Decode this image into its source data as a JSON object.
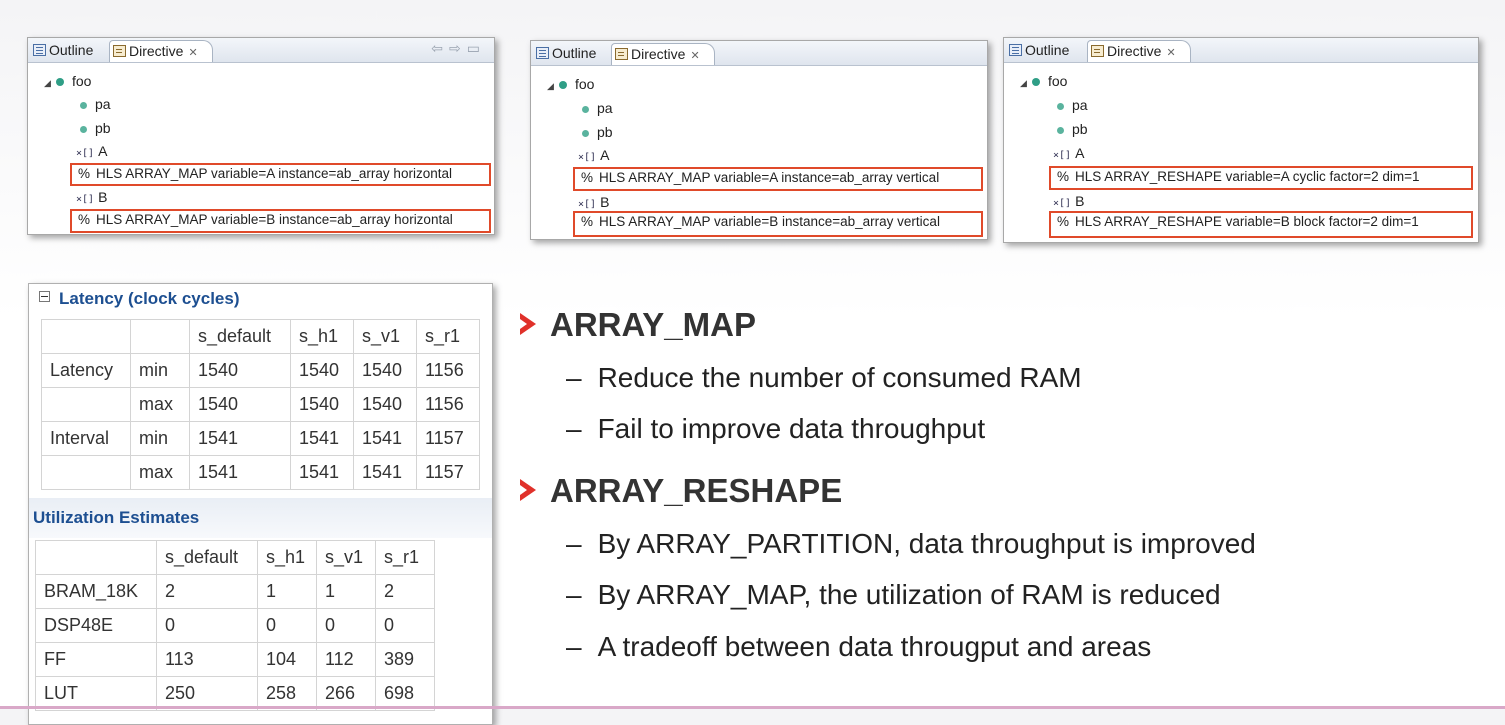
{
  "panels": [
    {
      "tabs": {
        "outline": "Outline",
        "directive": "Directive"
      },
      "tree": {
        "func": "foo",
        "ports": [
          "pa",
          "pb"
        ],
        "arrays": [
          "A",
          "B"
        ],
        "directives": [
          "HLS ARRAY_MAP variable=A instance=ab_array horizontal",
          "HLS ARRAY_MAP variable=B instance=ab_array horizontal"
        ]
      }
    },
    {
      "tabs": {
        "outline": "Outline",
        "directive": "Directive"
      },
      "tree": {
        "func": "foo",
        "ports": [
          "pa",
          "pb"
        ],
        "arrays": [
          "A",
          "B"
        ],
        "directives": [
          "HLS ARRAY_MAP variable=A instance=ab_array vertical",
          "HLS ARRAY_MAP variable=B instance=ab_array vertical"
        ]
      }
    },
    {
      "tabs": {
        "outline": "Outline",
        "directive": "Directive"
      },
      "tree": {
        "func": "foo",
        "ports": [
          "pa",
          "pb"
        ],
        "arrays": [
          "A",
          "B"
        ],
        "directives": [
          "HLS ARRAY_RESHAPE variable=A cyclic factor=2 dim=1",
          "HLS ARRAY_RESHAPE variable=B block factor=2 dim=1"
        ]
      }
    }
  ],
  "tree_symbols": {
    "pct": "%",
    "array_icon": "×[]"
  },
  "latency": {
    "title": "Latency (clock cycles)",
    "header": [
      "",
      "",
      "s_default",
      "s_h1",
      "s_v1",
      "s_r1"
    ],
    "rows": [
      [
        "Latency",
        "min",
        "1540",
        "1540",
        "1540",
        "1156"
      ],
      [
        "",
        "max",
        "1540",
        "1540",
        "1540",
        "1156"
      ],
      [
        "Interval",
        "min",
        "1541",
        "1541",
        "1541",
        "1157"
      ],
      [
        "",
        "max",
        "1541",
        "1541",
        "1541",
        "1157"
      ]
    ]
  },
  "utilization": {
    "title": "Utilization Estimates",
    "header": [
      "",
      "s_default",
      "s_h1",
      "s_v1",
      "s_r1"
    ],
    "rows": [
      [
        "BRAM_18K",
        "2",
        "1",
        "1",
        "2"
      ],
      [
        "DSP48E",
        "0",
        "0",
        "0",
        "0"
      ],
      [
        "FF",
        "113",
        "104",
        "112",
        "389"
      ],
      [
        "LUT",
        "250",
        "258",
        "266",
        "698"
      ]
    ]
  },
  "bullets": [
    {
      "title": "ARRAY_MAP",
      "items": [
        "Reduce the number of consumed RAM",
        "Fail to improve data throughput"
      ]
    },
    {
      "title": "ARRAY_RESHAPE",
      "items": [
        "By ARRAY_PARTITION, data throughput is improved",
        "By ARRAY_MAP, the utilization of RAM is reduced",
        "A tradeoff between data througput and areas"
      ]
    }
  ],
  "dash": "–",
  "colors": {
    "highlight_border": "#e04a2a",
    "section_head": "#1d4f91",
    "bullet_marker": "#e0312a",
    "tree_dot": "#2f9e86"
  }
}
